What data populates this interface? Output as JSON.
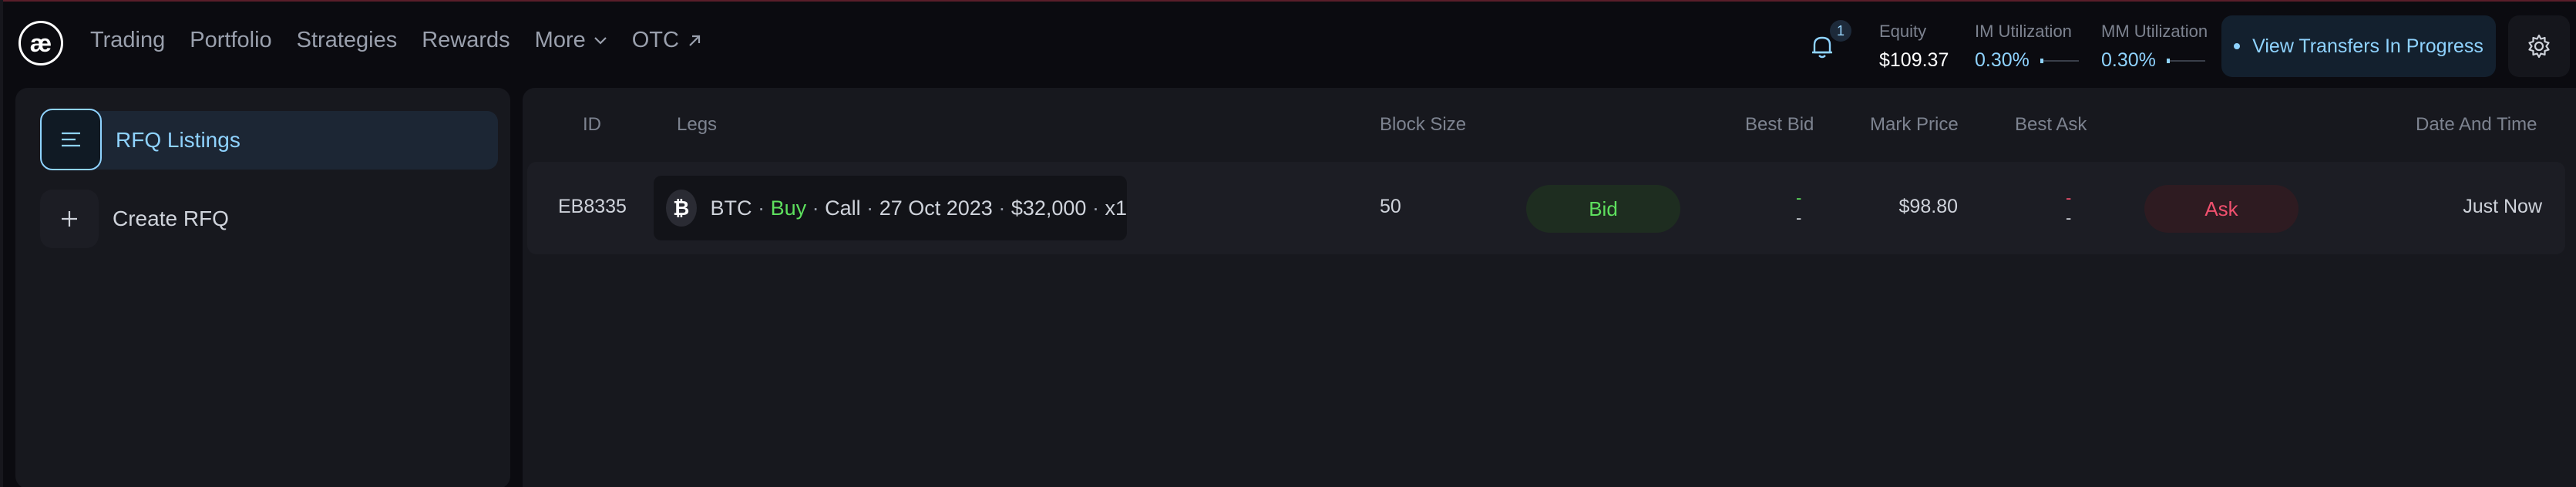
{
  "app": {
    "logo_text": "æ"
  },
  "nav": {
    "items": [
      {
        "label": "Trading"
      },
      {
        "label": "Portfolio"
      },
      {
        "label": "Strategies"
      },
      {
        "label": "Rewards"
      },
      {
        "label": "More",
        "icon": "chevron-down-icon"
      },
      {
        "label": "OTC",
        "icon": "external-arrow-icon"
      }
    ]
  },
  "header": {
    "notification_count": "1",
    "equity": {
      "label": "Equity",
      "value": "$109.37"
    },
    "im_utilization": {
      "label": "IM Utilization",
      "value": "0.30%"
    },
    "mm_utilization": {
      "label": "MM Utilization",
      "value": "0.30%"
    },
    "transfers_button": "View Transfers In Progress"
  },
  "sidebar": {
    "items": [
      {
        "label": "RFQ Listings",
        "icon": "list-icon",
        "active": true
      },
      {
        "label": "Create RFQ",
        "icon": "plus-icon",
        "active": false
      }
    ]
  },
  "table": {
    "columns": {
      "id": "ID",
      "legs": "Legs",
      "block_size": "Block Size",
      "best_bid": "Best Bid",
      "mark_price": "Mark Price",
      "best_ask": "Best Ask",
      "date_time": "Date And Time"
    },
    "rows": [
      {
        "id": "EB8335",
        "leg": {
          "asset": "BTC",
          "side": "Buy",
          "type": "Call",
          "expiry": "27 Oct 2023",
          "strike": "$32,000",
          "qty": "x1",
          "sep": "·",
          "icon": "bitcoin-icon"
        },
        "block_size": "50",
        "bid_button": "Bid",
        "best_bid": [
          "-",
          "-"
        ],
        "mark_price": "$98.80",
        "best_ask": [
          "-",
          "-"
        ],
        "ask_button": "Ask",
        "date_time": "Just Now"
      }
    ]
  },
  "colors": {
    "accent": "#8fd3ff",
    "buy": "#5ee05e",
    "sell": "#f0506e",
    "background": "#0b0b10",
    "panel": "#17181e"
  }
}
